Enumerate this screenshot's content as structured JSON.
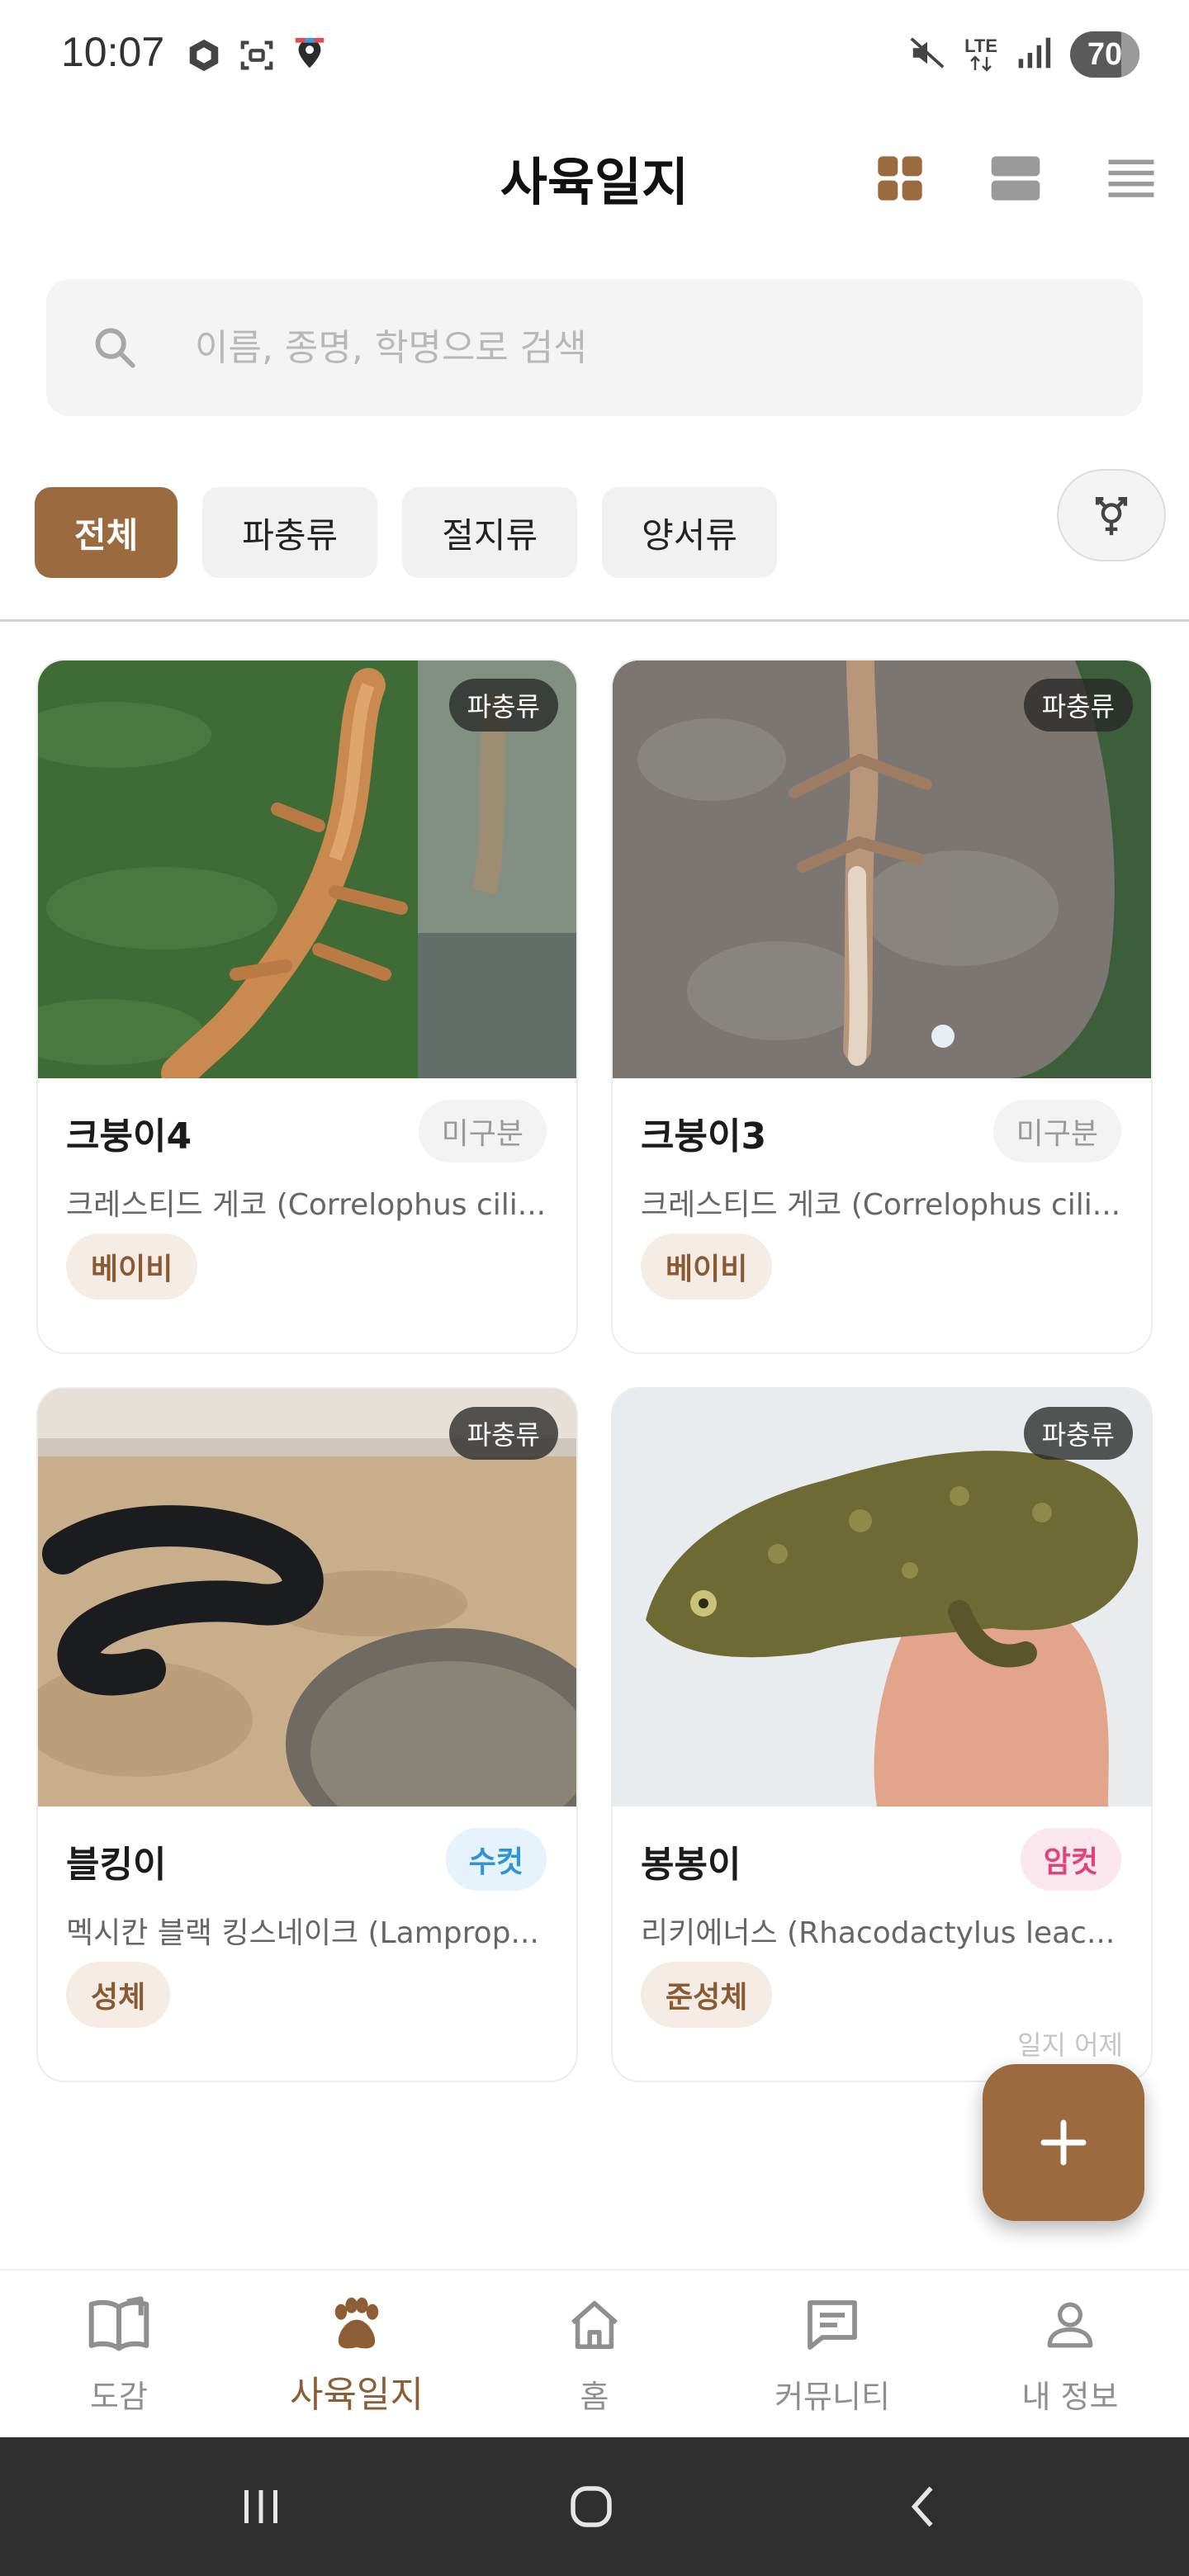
{
  "status_bar": {
    "time": "10:07",
    "network": "LTE",
    "battery": "70"
  },
  "header": {
    "title": "사육일지"
  },
  "search": {
    "placeholder": "이름, 종명, 학명으로 검색",
    "value": ""
  },
  "filters": {
    "chips": [
      {
        "label": "전체",
        "active": true
      },
      {
        "label": "파충류",
        "active": false
      },
      {
        "label": "절지류",
        "active": false
      },
      {
        "label": "양서류",
        "active": false
      }
    ]
  },
  "cards": [
    {
      "name": "크붕이4",
      "type": "파충류",
      "sex": "미구분",
      "species": "크레스티드 게코 (Correlophus cili...",
      "stage": "베이비",
      "note": ""
    },
    {
      "name": "크붕이3",
      "type": "파충류",
      "sex": "미구분",
      "species": "크레스티드 게코 (Correlophus cili...",
      "stage": "베이비",
      "note": ""
    },
    {
      "name": "블킹이",
      "type": "파충류",
      "sex": "수컷",
      "species": "멕시칸 블랙 킹스네이크 (Lamprop...",
      "stage": "성체",
      "note": ""
    },
    {
      "name": "봉봉이",
      "type": "파충류",
      "sex": "암컷",
      "species": "리키에너스 (Rhacodactylus leac...",
      "stage": "준성체",
      "note": "일지 어제"
    }
  ],
  "bottom_nav": [
    {
      "label": "도감",
      "icon": "book-icon",
      "active": false
    },
    {
      "label": "사육일지",
      "icon": "paw-icon",
      "active": true
    },
    {
      "label": "홈",
      "icon": "home-icon",
      "active": false
    },
    {
      "label": "커뮤니티",
      "icon": "chat-icon",
      "active": false
    },
    {
      "label": "내 정보",
      "icon": "person-icon",
      "active": false
    }
  ],
  "colors": {
    "accent": "#9b6a3f",
    "male": "#2f95d8",
    "female": "#e0457a"
  }
}
